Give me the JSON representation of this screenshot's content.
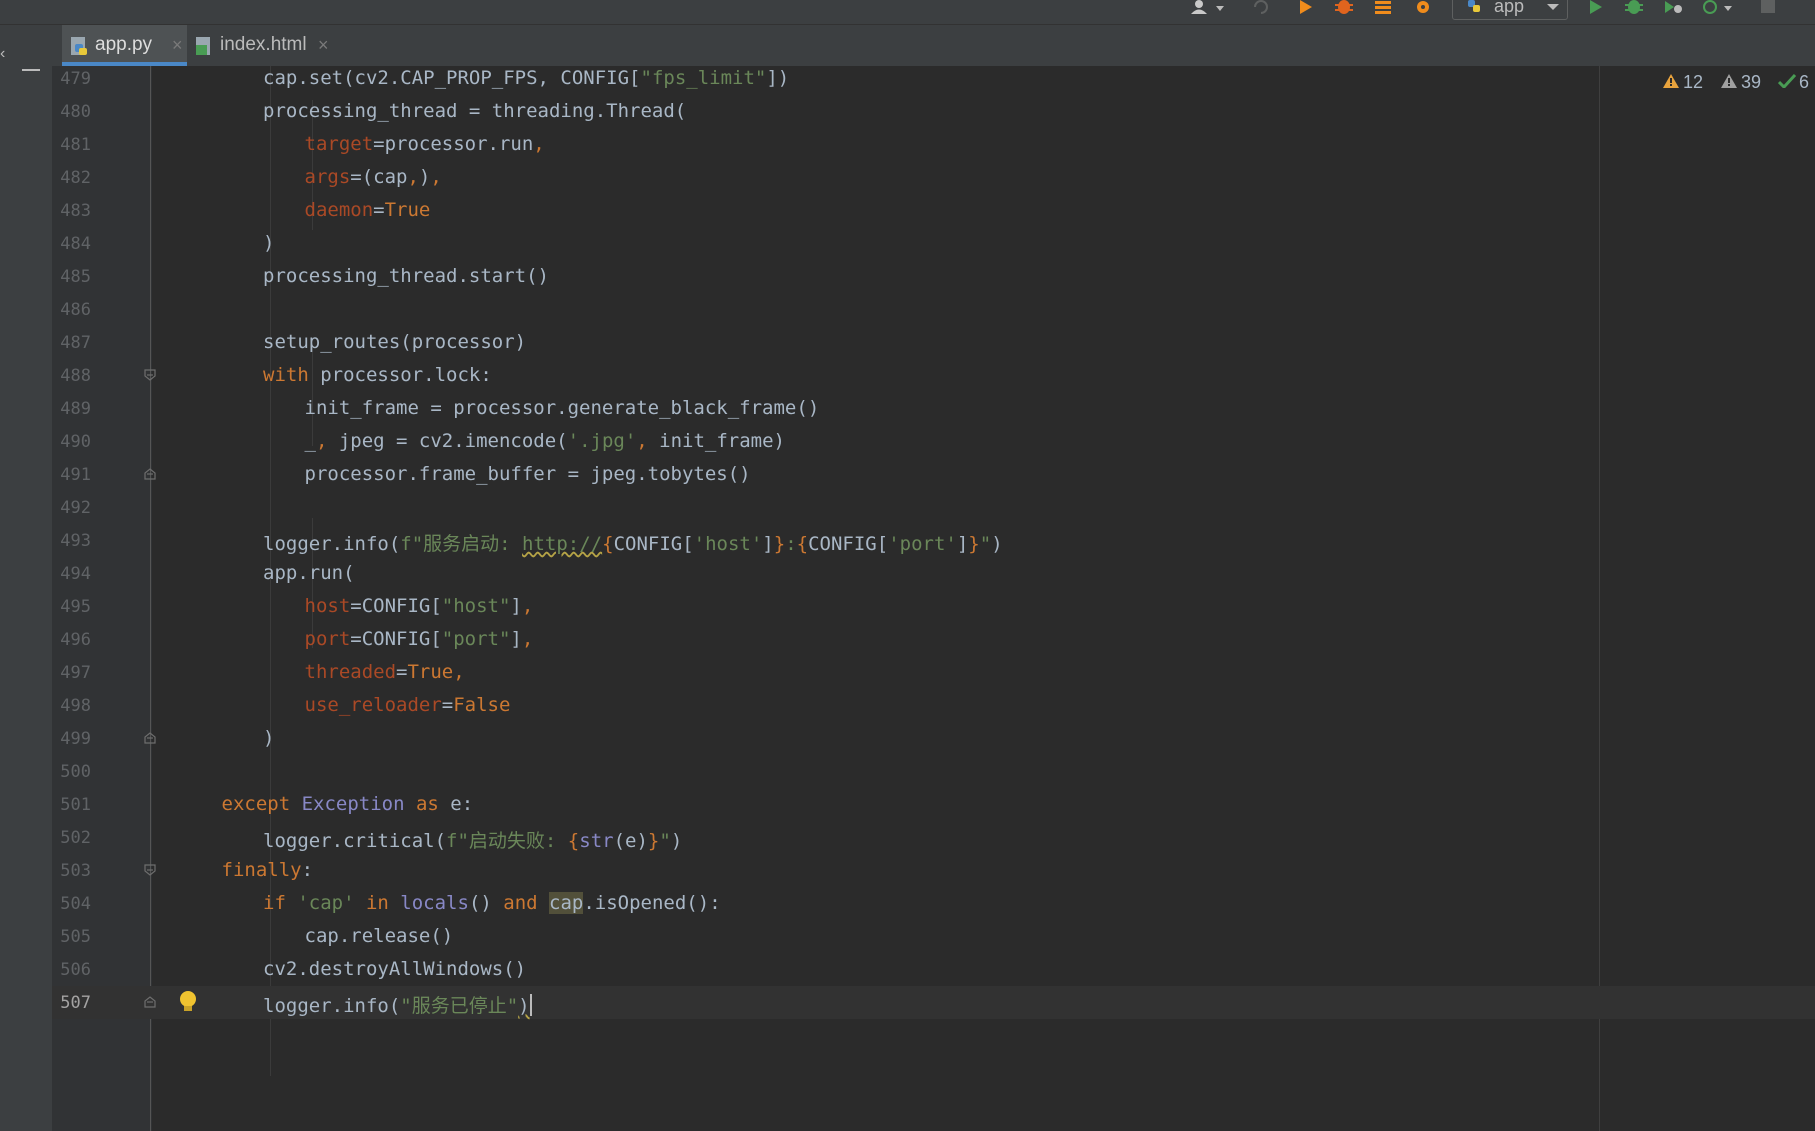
{
  "toolbar": {
    "run_config": "app",
    "icons": [
      "user-icon",
      "refresh-icon",
      "run-icon",
      "debug-icon",
      "coverage-icon",
      "profile-icon",
      "run-config-python-icon",
      "run-green-icon",
      "debug-green-icon",
      "coverage-green-icon",
      "profile-green-icon",
      "stop-icon"
    ]
  },
  "tabs": [
    {
      "label": "app.py",
      "icon": "python-file-icon",
      "active": true
    },
    {
      "label": "index.html",
      "icon": "html-file-icon",
      "active": false
    }
  ],
  "inspections": {
    "warnings": "12",
    "weak_warnings": "39",
    "ok": "6"
  },
  "colors": {
    "keyword": "#cc7832",
    "string": "#6a8759",
    "param": "#aa4926",
    "builtin": "#8888c6",
    "text": "#a9b7c6",
    "accent": "#4a88c7"
  },
  "editor": {
    "current_line": "507",
    "lines": [
      {
        "num": "479",
        "tokens": [
          {
            "t": "cap.set(cv2.CAP_PROP_FPS, CONFIG["
          },
          {
            "t": "\"fps_limit\"",
            "c": "s"
          },
          {
            "t": "])"
          }
        ]
      },
      {
        "num": "480",
        "tokens": [
          {
            "t": "processing_thread = threading.Thread("
          }
        ]
      },
      {
        "num": "481",
        "tokens": [
          {
            "t": "target",
            "c": "p"
          },
          {
            "t": "=processor.run"
          },
          {
            "t": ",",
            "c": "k"
          }
        ]
      },
      {
        "num": "482",
        "tokens": [
          {
            "t": "args",
            "c": "p"
          },
          {
            "t": "=(cap"
          },
          {
            "t": ",",
            "c": "k"
          },
          {
            "t": ")"
          },
          {
            "t": ",",
            "c": "k"
          }
        ]
      },
      {
        "num": "483",
        "tokens": [
          {
            "t": "daemon",
            "c": "p"
          },
          {
            "t": "="
          },
          {
            "t": "True",
            "c": "k"
          }
        ]
      },
      {
        "num": "484",
        "tokens": [
          {
            "t": ")"
          }
        ]
      },
      {
        "num": "485",
        "tokens": [
          {
            "t": "processing_thread.start()"
          }
        ]
      },
      {
        "num": "486",
        "tokens": []
      },
      {
        "num": "487",
        "tokens": [
          {
            "t": "setup_routes(processor)"
          }
        ]
      },
      {
        "num": "488",
        "tokens": [
          {
            "t": "with",
            "c": "k"
          },
          {
            "t": " processor.lock:"
          }
        ]
      },
      {
        "num": "489",
        "tokens": [
          {
            "t": "init_frame = processor.generate_black_frame()"
          }
        ]
      },
      {
        "num": "490",
        "tokens": [
          {
            "t": "_"
          },
          {
            "t": ",",
            "c": "k"
          },
          {
            "t": " jpeg = cv2.imencode("
          },
          {
            "t": "'.jpg'",
            "c": "s"
          },
          {
            "t": ",",
            "c": "k"
          },
          {
            "t": " init_frame)"
          }
        ]
      },
      {
        "num": "491",
        "tokens": [
          {
            "t": "processor.frame_buffer = jpeg.tobytes()"
          }
        ]
      },
      {
        "num": "492",
        "tokens": []
      },
      {
        "num": "493",
        "tokens": [
          {
            "t": "logger.info("
          },
          {
            "t": "f\"服务启动: ",
            "c": "s"
          },
          {
            "t": "http://",
            "c": "s",
            "squig": true
          },
          {
            "t": "{",
            "c": "k"
          },
          {
            "t": "CONFIG["
          },
          {
            "t": "'host'",
            "c": "s"
          },
          {
            "t": "]"
          },
          {
            "t": "}",
            "c": "k"
          },
          {
            "t": ":",
            "c": "s"
          },
          {
            "t": "{",
            "c": "k"
          },
          {
            "t": "CONFIG["
          },
          {
            "t": "'port'",
            "c": "s"
          },
          {
            "t": "]"
          },
          {
            "t": "}",
            "c": "k"
          },
          {
            "t": "\"",
            "c": "s"
          },
          {
            "t": ")"
          }
        ]
      },
      {
        "num": "494",
        "tokens": [
          {
            "t": "app.run("
          }
        ]
      },
      {
        "num": "495",
        "tokens": [
          {
            "t": "host",
            "c": "p"
          },
          {
            "t": "=CONFIG["
          },
          {
            "t": "\"host\"",
            "c": "s"
          },
          {
            "t": "]"
          },
          {
            "t": ",",
            "c": "k"
          }
        ]
      },
      {
        "num": "496",
        "tokens": [
          {
            "t": "port",
            "c": "p"
          },
          {
            "t": "=CONFIG["
          },
          {
            "t": "\"port\"",
            "c": "s"
          },
          {
            "t": "]"
          },
          {
            "t": ",",
            "c": "k"
          }
        ]
      },
      {
        "num": "497",
        "tokens": [
          {
            "t": "threaded",
            "c": "p"
          },
          {
            "t": "="
          },
          {
            "t": "True",
            "c": "k"
          },
          {
            "t": ",",
            "c": "k"
          }
        ]
      },
      {
        "num": "498",
        "tokens": [
          {
            "t": "use_reloader",
            "c": "p"
          },
          {
            "t": "="
          },
          {
            "t": "False",
            "c": "k"
          }
        ]
      },
      {
        "num": "499",
        "tokens": [
          {
            "t": ")"
          }
        ]
      },
      {
        "num": "500",
        "tokens": []
      },
      {
        "num": "501",
        "tokens": [
          {
            "t": "except ",
            "c": "k"
          },
          {
            "t": "Exception",
            "c": "b"
          },
          {
            "t": " as ",
            "c": "k"
          },
          {
            "t": "e:"
          }
        ]
      },
      {
        "num": "502",
        "tokens": [
          {
            "t": "logger.critical("
          },
          {
            "t": "f\"启动失败: ",
            "c": "s"
          },
          {
            "t": "{",
            "c": "k"
          },
          {
            "t": "str",
            "c": "b"
          },
          {
            "t": "(e)"
          },
          {
            "t": "}",
            "c": "k"
          },
          {
            "t": "\"",
            "c": "s"
          },
          {
            "t": ")"
          }
        ]
      },
      {
        "num": "503",
        "tokens": [
          {
            "t": "finally",
            "c": "k"
          },
          {
            "t": ":"
          }
        ]
      },
      {
        "num": "504",
        "tokens": [
          {
            "t": "if ",
            "c": "k"
          },
          {
            "t": "'cap'",
            "c": "s"
          },
          {
            "t": " in ",
            "c": "k"
          },
          {
            "t": "locals",
            "c": "b"
          },
          {
            "t": "() "
          },
          {
            "t": "and ",
            "c": "k"
          },
          {
            "t": "cap",
            "hl": true
          },
          {
            "t": ".isOpened():"
          }
        ]
      },
      {
        "num": "505",
        "tokens": [
          {
            "t": "cap.release()"
          }
        ]
      },
      {
        "num": "506",
        "tokens": [
          {
            "t": "cv2.destroyAllWindows()"
          }
        ]
      },
      {
        "num": "507",
        "tokens": [
          {
            "t": "logger.info("
          },
          {
            "t": "\"服务已停止\"",
            "c": "s"
          },
          {
            "t": ")",
            "squig": true
          }
        ]
      }
    ]
  }
}
